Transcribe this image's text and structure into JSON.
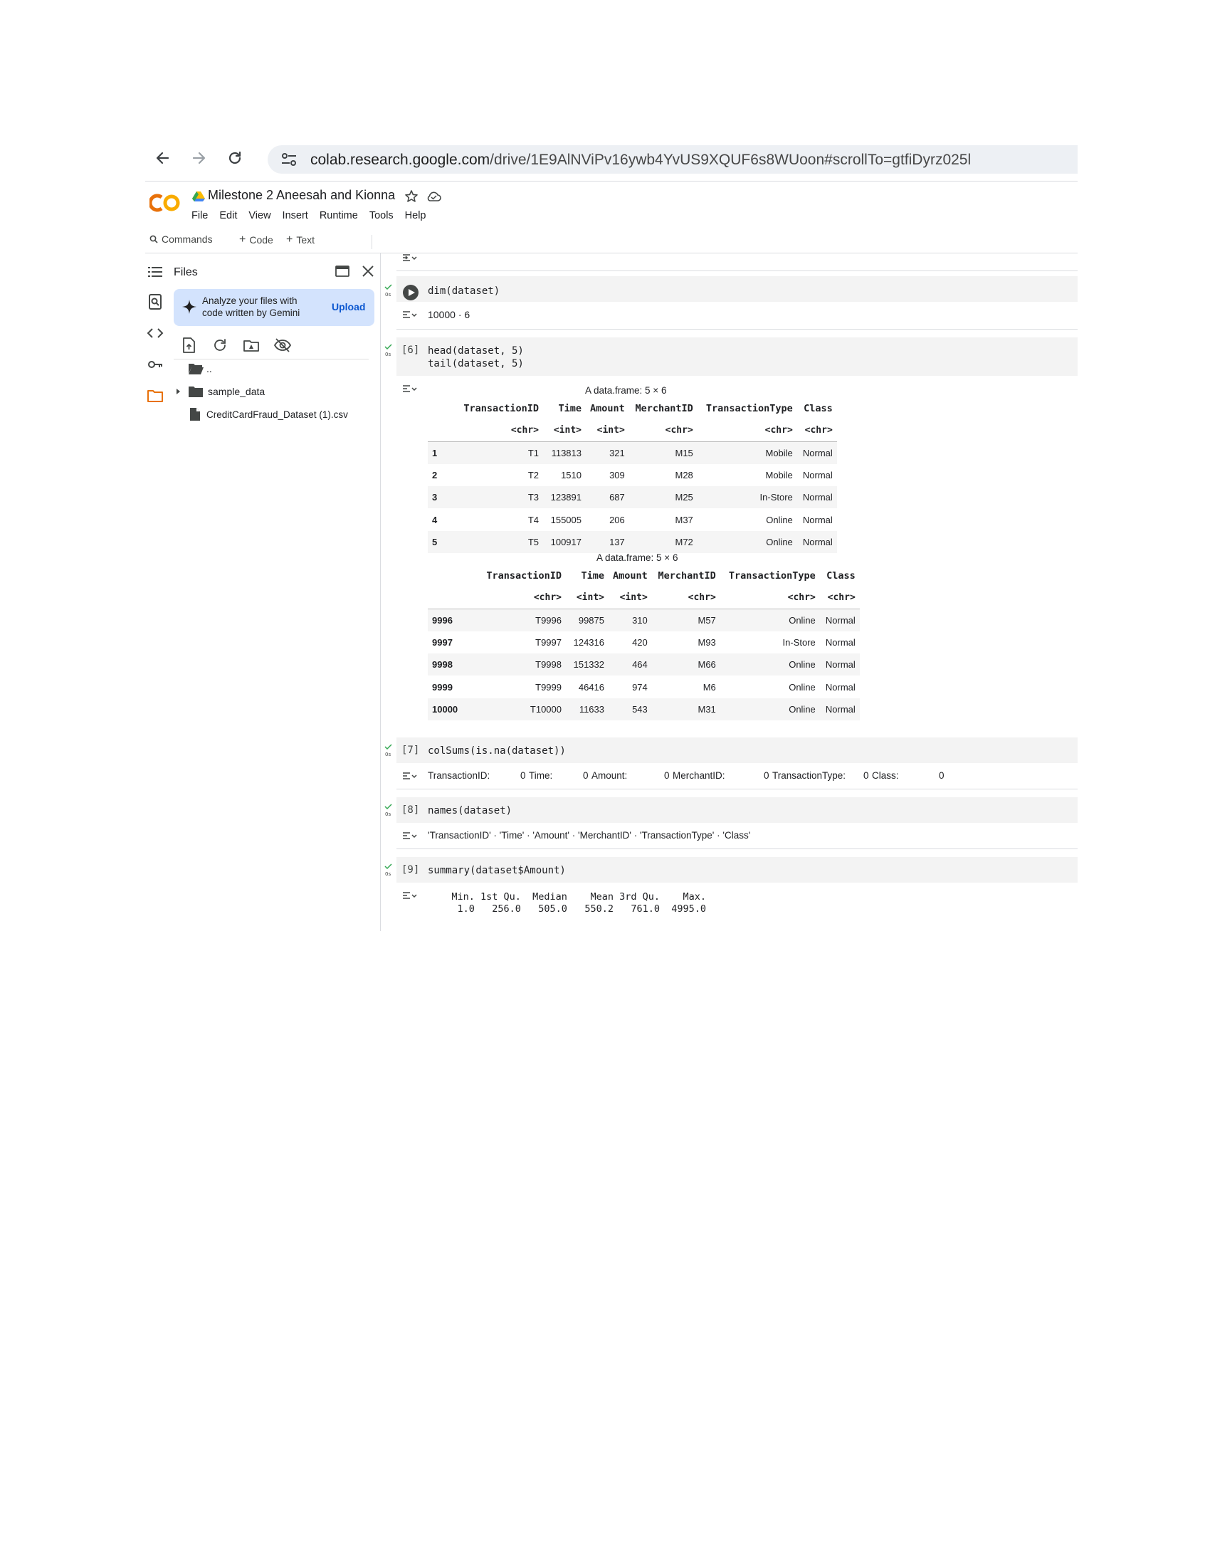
{
  "browser": {
    "url_host": "colab.research.google.com",
    "url_path": "/drive/1E9AlNViPv16ywb4YvUS9XQUF6s8WUoon#scrollTo=gtfiDyrz025l"
  },
  "header": {
    "title": "Milestone 2 Aneesah and Kionna",
    "menu": [
      "File",
      "Edit",
      "View",
      "Insert",
      "Runtime",
      "Tools",
      "Help"
    ]
  },
  "toolbar": {
    "commands": "Commands",
    "code": "Code",
    "text": "Text"
  },
  "files_panel": {
    "title": "Files",
    "gemini_text": "Analyze your files with code written by Gemini",
    "upload_label": "Upload",
    "tree": {
      "parent": "..",
      "folder": "sample_data",
      "file": "CreditCardFraud_Dataset (1).csv"
    }
  },
  "cells": {
    "dim": {
      "code": "dim(dataset)",
      "output": "10000 · 6"
    },
    "head_tail": {
      "count": "[6]",
      "code_line1": "head(dataset, 5)",
      "code_line2": "tail(dataset, 5)",
      "head_caption": "A data.frame: 5 × 6",
      "tail_caption": "A data.frame: 5 × 6",
      "columns": [
        "TransactionID",
        "Time",
        "Amount",
        "MerchantID",
        "TransactionType",
        "Class"
      ],
      "types": [
        "<chr>",
        "<int>",
        "<int>",
        "<chr>",
        "<chr>",
        "<chr>"
      ],
      "head_rows": [
        [
          "1",
          "T1",
          "113813",
          "321",
          "M15",
          "Mobile",
          "Normal"
        ],
        [
          "2",
          "T2",
          "1510",
          "309",
          "M28",
          "Mobile",
          "Normal"
        ],
        [
          "3",
          "T3",
          "123891",
          "687",
          "M25",
          "In-Store",
          "Normal"
        ],
        [
          "4",
          "T4",
          "155005",
          "206",
          "M37",
          "Online",
          "Normal"
        ],
        [
          "5",
          "T5",
          "100917",
          "137",
          "M72",
          "Online",
          "Normal"
        ]
      ],
      "tail_rows": [
        [
          "9996",
          "T9996",
          "99875",
          "310",
          "M57",
          "Online",
          "Normal"
        ],
        [
          "9997",
          "T9997",
          "124316",
          "420",
          "M93",
          "In-Store",
          "Normal"
        ],
        [
          "9998",
          "T9998",
          "151332",
          "464",
          "M66",
          "Online",
          "Normal"
        ],
        [
          "9999",
          "T9999",
          "46416",
          "974",
          "M6",
          "Online",
          "Normal"
        ],
        [
          "10000",
          "T10000",
          "11633",
          "543",
          "M31",
          "Online",
          "Normal"
        ]
      ]
    },
    "colsums": {
      "count": "[7]",
      "code": "colSums(is.na(dataset))",
      "output": [
        {
          "name": "TransactionID:",
          "value": "0"
        },
        {
          "name": "Time:",
          "value": "0"
        },
        {
          "name": "Amount:",
          "value": "0"
        },
        {
          "name": "MerchantID:",
          "value": "0"
        },
        {
          "name": "TransactionType:",
          "value": "0"
        },
        {
          "name": "Class:",
          "value": "0"
        }
      ]
    },
    "names": {
      "count": "[8]",
      "code": "names(dataset)",
      "output": "'TransactionID' · 'Time' · 'Amount' · 'MerchantID' · 'TransactionType' · 'Class'"
    },
    "summary": {
      "count": "[9]",
      "code": "summary(dataset$Amount)",
      "output_line1": "   Min. 1st Qu.  Median    Mean 3rd Qu.    Max. ",
      "output_line2": "    1.0   256.0   505.0   550.2   761.0  4995.0 "
    }
  },
  "exec_time": "0s",
  "colors": {
    "accent_orange": "#e8710a",
    "link_blue": "#0b57d0",
    "gemini_bg": "#d3e3fd",
    "tick_green": "#34a853"
  }
}
